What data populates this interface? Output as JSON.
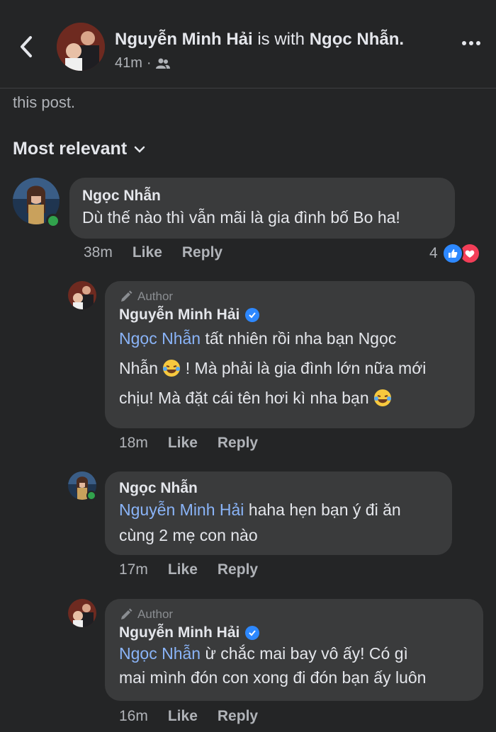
{
  "header": {
    "poster_name": "Nguyễn Minh Hải",
    "with_text": "is with",
    "tagged_name": "Ngọc Nhẫn.",
    "time": "41m",
    "separator": "·"
  },
  "post_tail": "this post.",
  "sort_label": "Most relevant",
  "comments": [
    {
      "author": "Ngọc Nhẫn",
      "text": "Dù thế nào thì vẫn mãi là gia đình bố Bo ha!",
      "time": "38m",
      "like": "Like",
      "reply": "Reply",
      "reaction_count": "4"
    },
    {
      "badge": "Author",
      "author": "Nguyễn Minh Hải",
      "mention": "Ngọc Nhẫn",
      "line1": "tất nhiên rồi nha bạn Ngọc",
      "line2a": "Nhẫn",
      "line2b": "! Mà phải là gia đình lớn nữa mới",
      "line3": "chịu! Mà đặt cái tên hơi kì nha bạn",
      "time": "18m",
      "like": "Like",
      "reply": "Reply"
    },
    {
      "author": "Ngọc Nhẫn",
      "mention": "Nguyễn Minh Hải",
      "line1": "haha hẹn bạn ý đi ăn",
      "line2": "cùng 2 mẹ con nào",
      "time": "17m",
      "like": "Like",
      "reply": "Reply"
    },
    {
      "badge": "Author",
      "author": "Nguyễn Minh Hải",
      "mention": "Ngọc Nhẫn",
      "line1": "ừ chắc mai bay vô ấy! Có gì",
      "line2": "mai mình đón con xong đi đón bạn ấy luôn",
      "time": "16m",
      "like": "Like",
      "reply": "Reply"
    }
  ],
  "colors": {
    "background": "#242526",
    "bubble": "#3a3b3c",
    "mention": "#8ab4f8",
    "like_reaction": "#2d88ff",
    "love_reaction": "#f33e58"
  },
  "icons": [
    "back-chevron-icon",
    "friends-audience-icon",
    "more-options-icon",
    "chevron-down-icon",
    "pencil-icon",
    "verified-badge-icon",
    "like-reaction-icon",
    "love-reaction-icon",
    "laughing-tears-emoji"
  ]
}
